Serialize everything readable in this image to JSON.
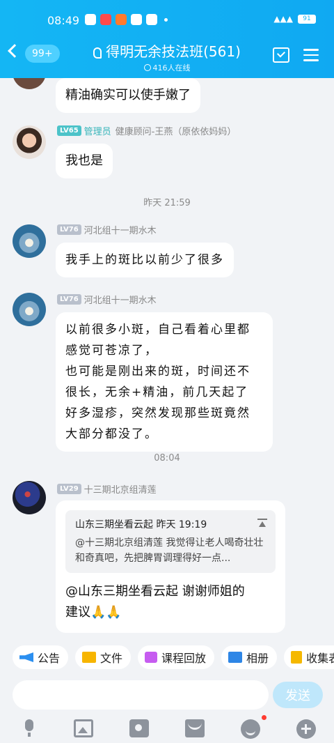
{
  "status_bar": {
    "time": "08:49",
    "battery": "91"
  },
  "header": {
    "unread_badge": "99+",
    "title": "得明无余技法班(561)",
    "online_count": "416人在线"
  },
  "messages": [
    {
      "type": "partial_text",
      "text": "精油确实可以使手嫩了"
    },
    {
      "level": "LV65",
      "role": "管理员",
      "sender": "健康顾问-王燕（原依依妈妈）",
      "text": "我也是"
    },
    {
      "timestamp": "昨天 21:59"
    },
    {
      "level": "LV76",
      "sender": "河北组十一期水木",
      "text": "我手上的斑比以前少了很多"
    },
    {
      "level": "LV76",
      "sender": "河北组十一期水木",
      "lines": [
        "以前很多小斑，自己看着心里都",
        "感觉可苍凉了，",
        "也可能是刚出来的斑，时间还不",
        "很长，无余+精油，前几天起了",
        "好多湿疹，突然发现那些斑竟然",
        "大部分都没了。"
      ]
    },
    {
      "timestamp": "08:04"
    },
    {
      "level": "LV29",
      "sender": "十三期北京组清莲",
      "quote": {
        "author_time": "山东三期坐看云起 昨天 19:19",
        "body": "@十三期北京组清莲 我觉得让老人喝奇壮壮和奇真吧，先把脾胃调理得好一点..."
      },
      "reply_lines": [
        "@山东三期坐看云起 谢谢师姐的",
        "建议🙏🙏"
      ]
    }
  ],
  "shortcuts": [
    "公告",
    "文件",
    "课程回放",
    "相册",
    "收集表"
  ],
  "input": {
    "placeholder": "",
    "send_label": "发送"
  },
  "colors": {
    "header": "#14b6f4",
    "background": "#f1f3f6",
    "admin": "#37b5ba"
  }
}
